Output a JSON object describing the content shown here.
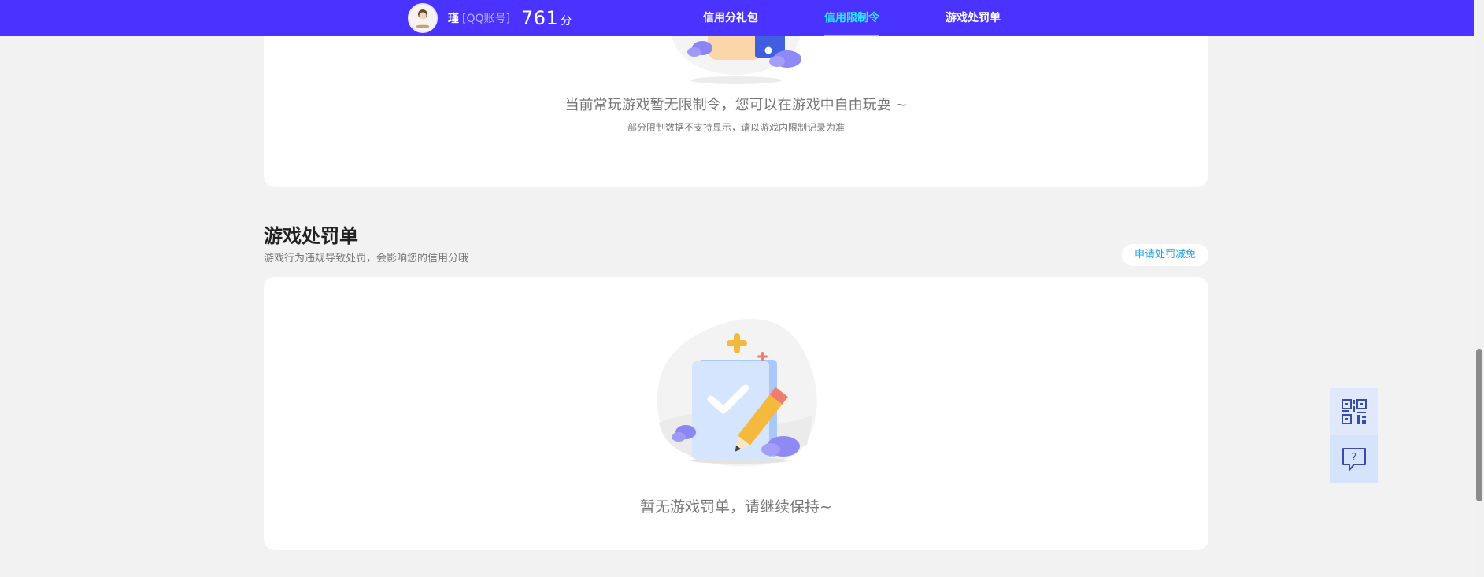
{
  "header": {
    "user_name": "瑾",
    "account_type": "[QQ账号]",
    "score": "761",
    "score_unit": "分",
    "tabs": [
      {
        "label": "信用分礼包",
        "active": false
      },
      {
        "label": "信用限制令",
        "active": true
      },
      {
        "label": "游戏处罚单",
        "active": false
      }
    ],
    "bar_color": "#4b33ff",
    "active_tab_color": "#2be9ff"
  },
  "restriction": {
    "message": "当前常玩游戏暂无限制令，您可以在游戏中自由玩耍 ~",
    "note": "部分限制数据不支持显示，请以游戏内限制记录为准"
  },
  "penalty": {
    "title": "游戏处罚单",
    "description": "游戏行为违规导致处罚，会影响您的信用分哦",
    "apply_button": "申请处罚减免",
    "empty_message": "暂无游戏罚单，请继续保持~"
  },
  "float_buttons": {
    "qr_icon": "qr-code-icon",
    "help_icon": "help-chat-icon"
  }
}
